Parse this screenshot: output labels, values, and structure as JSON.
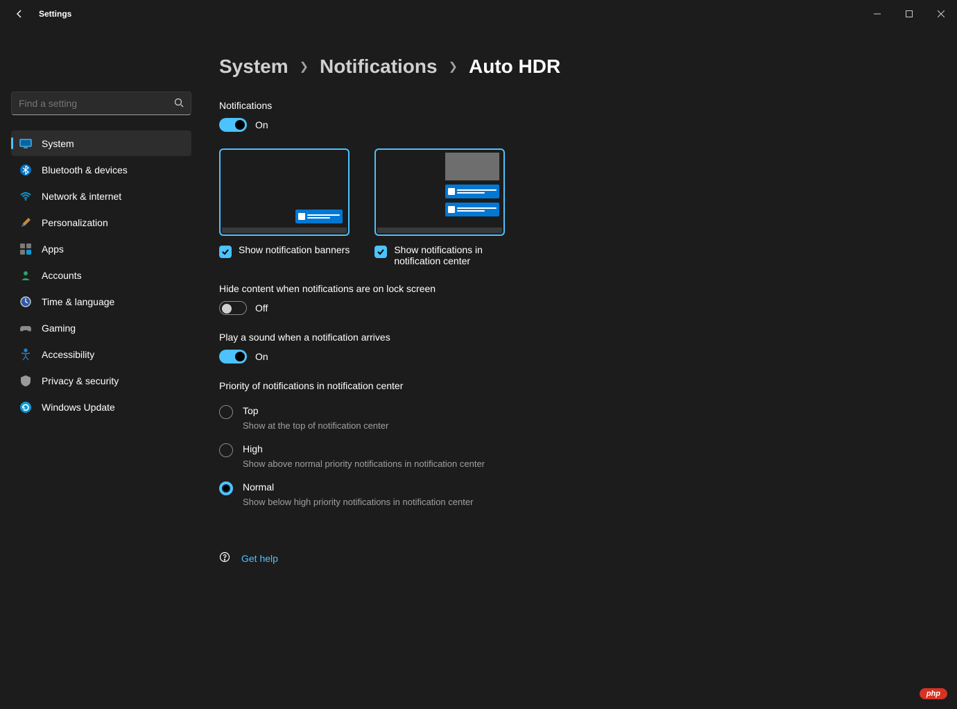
{
  "window": {
    "title": "Settings"
  },
  "search": {
    "placeholder": "Find a setting"
  },
  "sidebar": {
    "items": [
      {
        "label": "System"
      },
      {
        "label": "Bluetooth & devices"
      },
      {
        "label": "Network & internet"
      },
      {
        "label": "Personalization"
      },
      {
        "label": "Apps"
      },
      {
        "label": "Accounts"
      },
      {
        "label": "Time & language"
      },
      {
        "label": "Gaming"
      },
      {
        "label": "Accessibility"
      },
      {
        "label": "Privacy & security"
      },
      {
        "label": "Windows Update"
      }
    ]
  },
  "breadcrumb": {
    "0": "System",
    "1": "Notifications",
    "2": "Auto HDR"
  },
  "notifications": {
    "label": "Notifications",
    "state_label": "On"
  },
  "preview": {
    "banners_label": "Show notification banners",
    "center_label": "Show notifications in notification center"
  },
  "lock_hide": {
    "label": "Hide content when notifications are on lock screen",
    "state_label": "Off"
  },
  "sound": {
    "label": "Play a sound when a notification arrives",
    "state_label": "On"
  },
  "priority": {
    "label": "Priority of notifications in notification center",
    "options": [
      {
        "title": "Top",
        "desc": "Show at the top of notification center"
      },
      {
        "title": "High",
        "desc": "Show above normal priority notifications in notification center"
      },
      {
        "title": "Normal",
        "desc": "Show below high priority notifications in notification center"
      }
    ]
  },
  "help": {
    "label": "Get help"
  },
  "badge": {
    "label": "php"
  },
  "colors": {
    "accent": "#4cc2ff",
    "background": "#1c1c1c"
  }
}
